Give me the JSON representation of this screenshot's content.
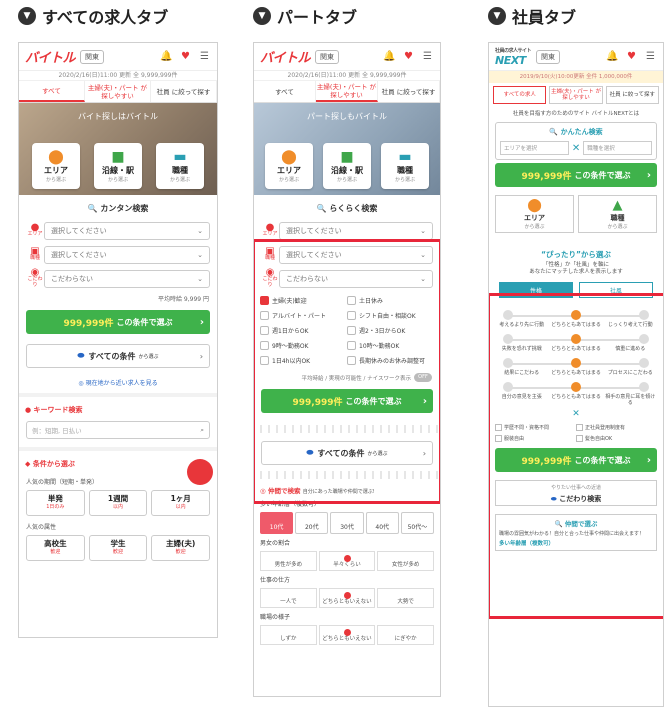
{
  "headers": {
    "c1": "すべての求人タブ",
    "c2": "パートタブ",
    "c3": "社員タブ"
  },
  "app": {
    "logo": "バイトル",
    "logo_next": "NEXT",
    "logo_next_small": "社員の求人サイト",
    "region": "関東",
    "icon_labels": [
      "お知らせ",
      "キープ",
      "メニュー"
    ],
    "update_line": "2020/2/16(日)11:00 更新  全 9,999,999件"
  },
  "tabs": {
    "all": "すべて",
    "part": "主婦(夫)・パート が探しやすい",
    "shain": "社員 に絞って探す"
  },
  "hero": {
    "caption1": "バイト探しはバイトル",
    "caption2": "パート探しもバイトル"
  },
  "cats": [
    {
      "title": "エリア",
      "sub": "から選ぶ"
    },
    {
      "title": "沿線・駅",
      "sub": "から選ぶ"
    },
    {
      "title": "職種",
      "sub": "から選ぶ"
    }
  ],
  "search": {
    "title1": "カンタン検索",
    "title2": "らくらく検索",
    "area_label": "エリア",
    "job_label": "職種",
    "pref_label": "こだわり",
    "area_placeholder": "選択してください",
    "job_placeholder": "選択してください",
    "pref_placeholder": "こだわらない",
    "avg": "平均時給 9,999 円",
    "count": "999,999件",
    "btn": "この条件で選ぶ"
  },
  "all_conditions": "すべての条件",
  "all_conditions_sub": "から選ぶ",
  "nearby": "現在地から近い求人を見る",
  "keyword": {
    "title": "キーワード検索",
    "placeholder": "例：短期, 日払い"
  },
  "condition": {
    "title": "条件から選ぶ",
    "period_label": "人気の期間（短期・単発）",
    "period": [
      {
        "main": "単発",
        "sub": "1日のみ"
      },
      {
        "main": "1週間",
        "sub": "以内"
      },
      {
        "main": "1ヶ月",
        "sub": "以内"
      }
    ],
    "attr_label": "人気の属性",
    "attr": [
      {
        "main": "高校生",
        "sub": "歓迎"
      },
      {
        "main": "学生",
        "sub": "歓迎"
      },
      {
        "main": "主婦(夫)",
        "sub": "歓迎"
      }
    ]
  },
  "part_checks": [
    {
      "label": "主婦(夫)歓迎",
      "on": true
    },
    {
      "label": "土日休み",
      "on": false
    },
    {
      "label": "アルバイト・パート",
      "on": false
    },
    {
      "label": "シフト自由・相談OK",
      "on": false
    },
    {
      "label": "週1日からOK",
      "on": false
    },
    {
      "label": "週2・3日からOK",
      "on": false
    },
    {
      "label": "9時〜勤務OK",
      "on": false
    },
    {
      "label": "10時〜勤務OK",
      "on": false
    },
    {
      "label": "1日4h以内OK",
      "on": false
    },
    {
      "label": "長期休みのお休み調整可",
      "on": false
    }
  ],
  "toggle_label": "平均時給 / 実現の可能性 / ナイスワーク表示",
  "toggle_state": "OFF",
  "nakama": {
    "title": "仲間で検索",
    "title_sub": "自分にあった職場や仲間で選ぶ!",
    "age_label": "多い年齢層（複数可）",
    "ages": [
      {
        "label": "10代",
        "on": true
      },
      {
        "label": "20代",
        "on": false
      },
      {
        "label": "30代",
        "on": false
      },
      {
        "label": "40代",
        "on": false
      },
      {
        "label": "50代〜",
        "on": false
      }
    ],
    "gender_label": "男女の割合",
    "gender": [
      "男性が多め",
      "半々くらい",
      "女性が多め"
    ],
    "work_label": "仕事の仕方",
    "work": [
      "一人で",
      "どちらともいえない",
      "大勢で"
    ],
    "vibe_label": "職場の様子",
    "vibe": [
      "しずか",
      "どちらともいえない",
      "にぎやか"
    ]
  },
  "next": {
    "update_line": "2019/9/10(火)10:00更新  全件 1,000,000件",
    "tabs": [
      "すべての求人",
      "主婦(夫)・パート が探しやすい",
      "社員 に絞って探す"
    ],
    "banner": "社員を目指す方のためのサイト バイトルNEXTとは",
    "easy_title": "かんたん検索",
    "area_sel": "エリアを選択",
    "job_sel": "職種を選択",
    "count": "999,999件",
    "btn": "この条件で選ぶ",
    "cats": [
      {
        "title": "エリア",
        "sub": "から選ぶ"
      },
      {
        "title": "職種",
        "sub": "から選ぶ"
      }
    ],
    "pt_title": "“ぴったり”から選ぶ",
    "pt_sub1": "「性格」か「社風」を軸に",
    "pt_sub2": "あなたにマッチした求人を表示します",
    "seg": [
      "性格",
      "社風"
    ],
    "rows": [
      [
        "考えるより先に行動",
        "どちらともあてはまる",
        "じっくり考えて行動"
      ],
      [
        "失敗を恐れず挑戦",
        "どちらともあてはまる",
        "慎重に進める"
      ],
      [
        "結果にこだわる",
        "どちらともあてはまる",
        "プロセスにこだわる"
      ],
      [
        "自分の意見を主張",
        "どちらともあてはまる",
        "相手の意見に耳を傾ける"
      ]
    ],
    "checks": [
      "学歴不問・資格不問",
      "正社員登用制度有",
      "服装自由",
      "髪色自由OK"
    ],
    "pref_sub": "やりたい仕事への近道",
    "pref": "こだわり検索",
    "bot_title": "仲間で選ぶ",
    "bot_desc": "職場の雰囲気がわかる！自分と合った仕事や仲間に出会えます！",
    "bot_foot": "多い年齢層（複数可）"
  }
}
